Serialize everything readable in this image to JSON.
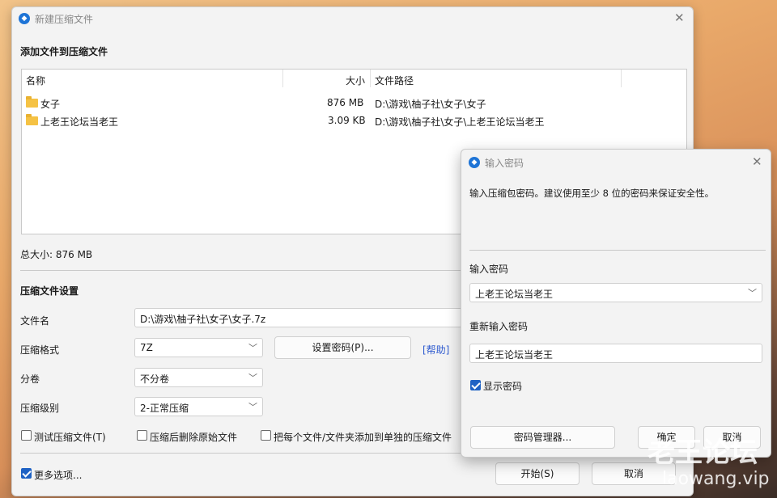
{
  "main_window": {
    "title": "新建压缩文件",
    "add_files_heading": "添加文件到压缩文件",
    "columns": {
      "name": "名称",
      "size": "大小",
      "path": "文件路径"
    },
    "files": [
      {
        "name": "女子",
        "size": "876 MB",
        "path": "D:\\游戏\\柚子社\\女子\\女子",
        "icon": "folder-icon"
      },
      {
        "name": "上老王论坛当老王",
        "size": "3.09 KB",
        "path": "D:\\游戏\\柚子社\\女子\\上老王论坛当老王",
        "icon": "folder-icon"
      }
    ],
    "total_size": "总大小: 876 MB",
    "settings_heading": "压缩文件设置",
    "filename_label": "文件名",
    "filename_value": "D:\\游戏\\柚子社\\女子\\女子.7z",
    "format_label": "压缩格式",
    "format_value": "7Z",
    "set_password_button": "设置密码(P)...",
    "help_link": "[帮助]",
    "volume_label": "分卷",
    "volume_value": "不分卷",
    "level_label": "压缩级别",
    "level_value": "2-正常压缩",
    "test_checkbox": "测试压缩文件(T)",
    "delete_checkbox": "压缩后删除原始文件",
    "each_checkbox": "把每个文件/文件夹添加到单独的压缩文件",
    "more_options": "更多选项...",
    "start_button": "开始(S)",
    "cancel_button": "取消"
  },
  "password_dialog": {
    "title": "输入密码",
    "description": "输入压缩包密码。建议使用至少 8 位的密码来保证安全性。",
    "password_label": "输入密码",
    "password_value": "上老王论坛当老王",
    "reenter_label": "重新输入密码",
    "reenter_value": "上老王论坛当老王",
    "show_password": "显示密码",
    "manager_button": "密码管理器...",
    "ok_button": "确定",
    "cancel_button": "取消"
  },
  "watermark": {
    "text": "老王论坛",
    "url": "laowang.vip"
  },
  "colors": {
    "accent": "#1f62c4",
    "link": "#2f5bd0",
    "folder": "#f5c244"
  }
}
